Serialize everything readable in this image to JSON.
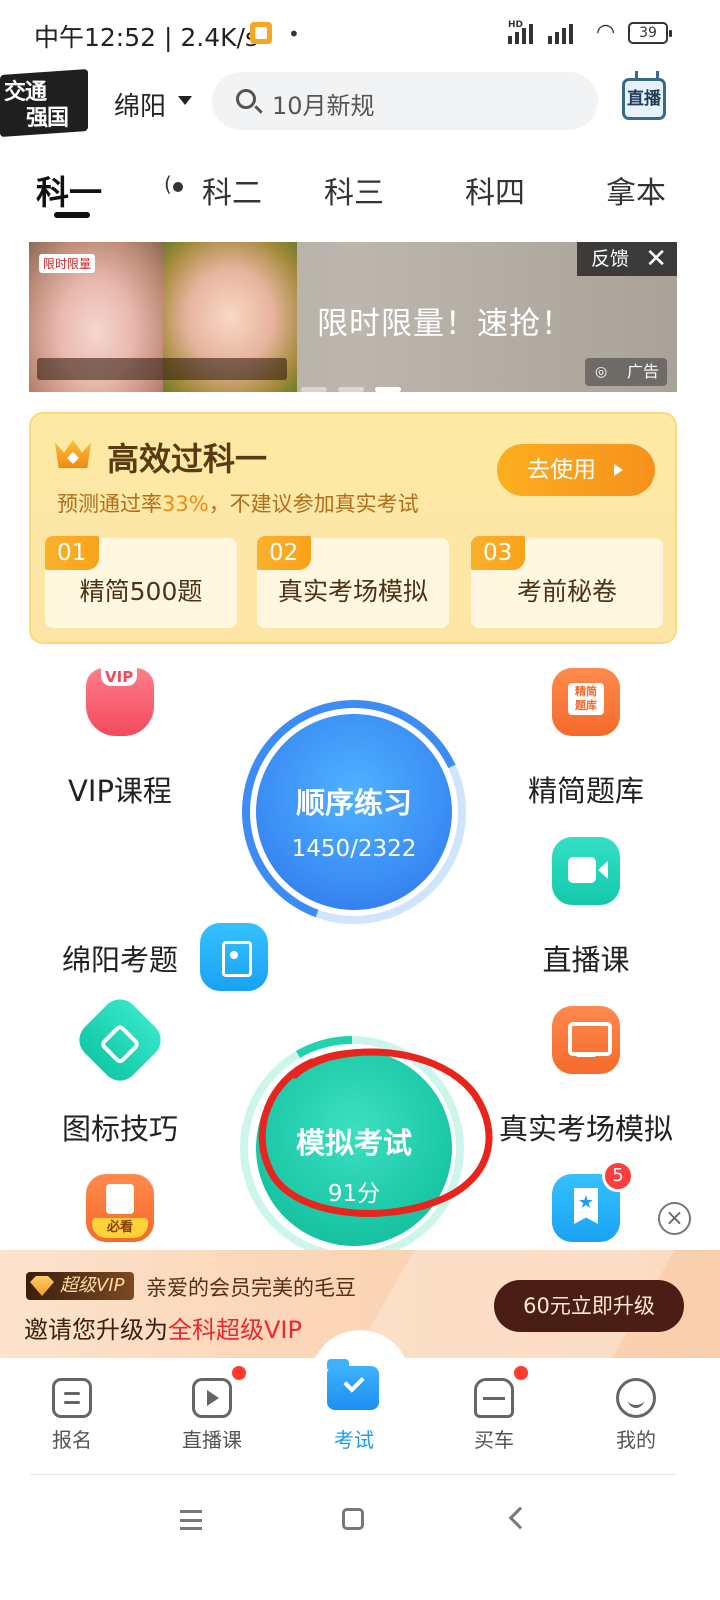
{
  "status_bar": {
    "time_speed": "中午12:52 | 2.4K/s",
    "hd_label": "HD",
    "battery": "39",
    "icons": [
      "notification-icon",
      "signal-icon",
      "wifi-icon",
      "battery-icon"
    ]
  },
  "header": {
    "logo_line1": "交通",
    "logo_line2": "强国",
    "city": "绵阳",
    "search_placeholder": "10月新规",
    "live_button": "直播"
  },
  "subject_tabs": [
    "科一",
    "科二",
    "科三",
    "科四",
    "拿本"
  ],
  "active_tab": "科一",
  "ad_banner": {
    "slogan": "限时限量！速抢！",
    "feedback": "反馈",
    "close": "✕",
    "ad_label": "广告",
    "image_brand": "限时限量"
  },
  "efficiency_card": {
    "title": "高效过科一",
    "subtitle_prefix": "预测通过率",
    "pass_rate": "33%",
    "subtitle_suffix": "，不建议参加真实考试",
    "cta": "去使用",
    "steps": [
      {
        "num": "01",
        "label": "精简500题"
      },
      {
        "num": "02",
        "label": "真实考场模拟"
      },
      {
        "num": "03",
        "label": "考前秘卷"
      }
    ]
  },
  "features": {
    "vip_course": "VIP课程",
    "question_bank": "精简题库",
    "city_questions": "绵阳考题",
    "live_course": "直播课",
    "sign_tips": "图标技巧",
    "real_exam_sim": "真实考场模拟",
    "favorites_badge": "5"
  },
  "practice": {
    "sequence_label": "顺序练习",
    "sequence_progress": "1450/2322",
    "sequence_done": 1450,
    "sequence_total": 2322,
    "mock_label": "模拟考试",
    "mock_score": "91分"
  },
  "vip_promo": {
    "tag": "超级VIP",
    "greeting": "亲爱的会员完美的毛豆",
    "invite_prefix": "邀请您升级为",
    "invite_highlight": "全科超级VIP",
    "upgrade_button": "60元立即升级"
  },
  "bottom_nav": [
    {
      "label": "报名",
      "icon": "signup-icon"
    },
    {
      "label": "直播课",
      "icon": "live-tv-icon"
    },
    {
      "label": "考试",
      "icon": "exam-folder-icon"
    },
    {
      "label": "买车",
      "icon": "car-icon"
    },
    {
      "label": "我的",
      "icon": "profile-icon"
    }
  ],
  "colors": {
    "accent_blue": "#1d9bf0",
    "mock_green": "#1cc9a8",
    "sequence_blue": "#3b8ef5",
    "annotation_red": "#e8241c",
    "vip_dark": "#4a1d15"
  }
}
